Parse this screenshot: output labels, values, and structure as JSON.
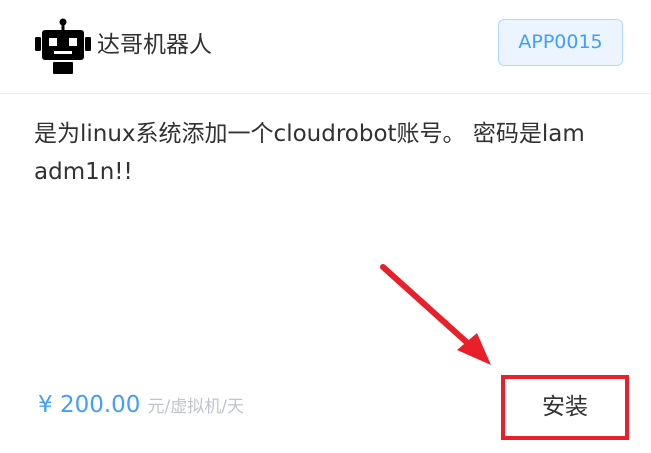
{
  "app": {
    "name": "达哥机器人",
    "tag": "APP0015",
    "logo_icon": "robot-icon",
    "description": "是为linux系统添加一个cloudrobot账号。 密码是lamadm1n!!"
  },
  "pricing": {
    "value": "¥ 200.00",
    "unit": "元/虚拟机/天"
  },
  "actions": {
    "install_label": "安装"
  },
  "colors": {
    "accent": "#409eff",
    "highlight": "#e8202a"
  }
}
